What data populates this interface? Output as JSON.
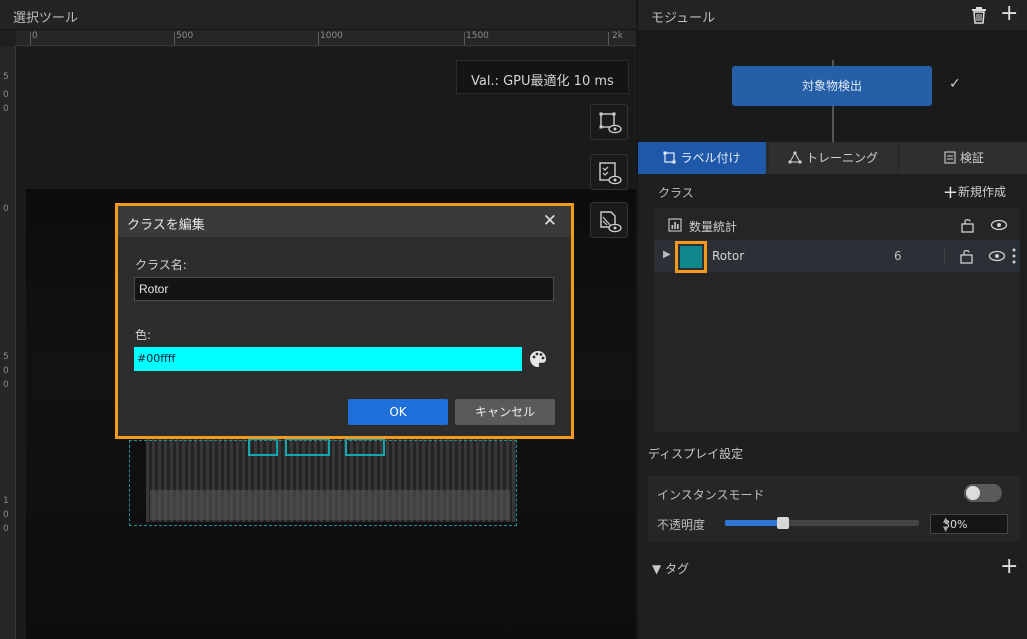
{
  "left_panel": {
    "title": "選択ツール",
    "ruler_top_labels": [
      "0",
      "500",
      "1000",
      "1500",
      "2k"
    ],
    "ruler_left_labels": [
      "5",
      "0",
      "0",
      "0",
      "5",
      "0",
      "0",
      "1",
      "0",
      "0"
    ],
    "val_badge": "Val.: GPU最適化 10 ms",
    "tools": [
      {
        "icon": "bbox-eye-icon"
      },
      {
        "icon": "checklist-eye-icon"
      },
      {
        "icon": "mask-eye-icon"
      }
    ]
  },
  "dialog": {
    "title": "クラスを編集",
    "close_glyph": "✕",
    "name_label": "クラス名:",
    "name_value": "Rotor",
    "color_label": "色:",
    "color_value": "#00ffff",
    "color_hex_display": "#00ffff",
    "ok_label": "OK",
    "cancel_label": "キャンセル",
    "highlight_color": "#f59a1e"
  },
  "module_panel": {
    "title": "モジュール",
    "module_button": "対象物検出",
    "module_status_glyph": "✓",
    "add_glyph": "+",
    "tabs": [
      {
        "label": "ラベル付け",
        "active": true
      },
      {
        "label": "トレーニング",
        "active": false
      },
      {
        "label": "検証",
        "active": false
      }
    ],
    "classes_title": "クラス",
    "new_create_label": "新規作成",
    "stats_label": "数量統計",
    "classes": [
      {
        "name": "Rotor",
        "count": "6",
        "color": "#11868c",
        "expand_glyph": "▶"
      }
    ],
    "display": {
      "title": "ディスプレイ設定",
      "instance_mode_label": "インスタンスモード",
      "instance_mode_on": false,
      "opacity_label": "不透明度",
      "opacity_value": "30%",
      "opacity_fraction": 0.3,
      "spin_up_glyph": "▲",
      "spin_down_glyph": "▼"
    },
    "tag_label": "▼ タグ",
    "tag_add_glyph": "+"
  }
}
